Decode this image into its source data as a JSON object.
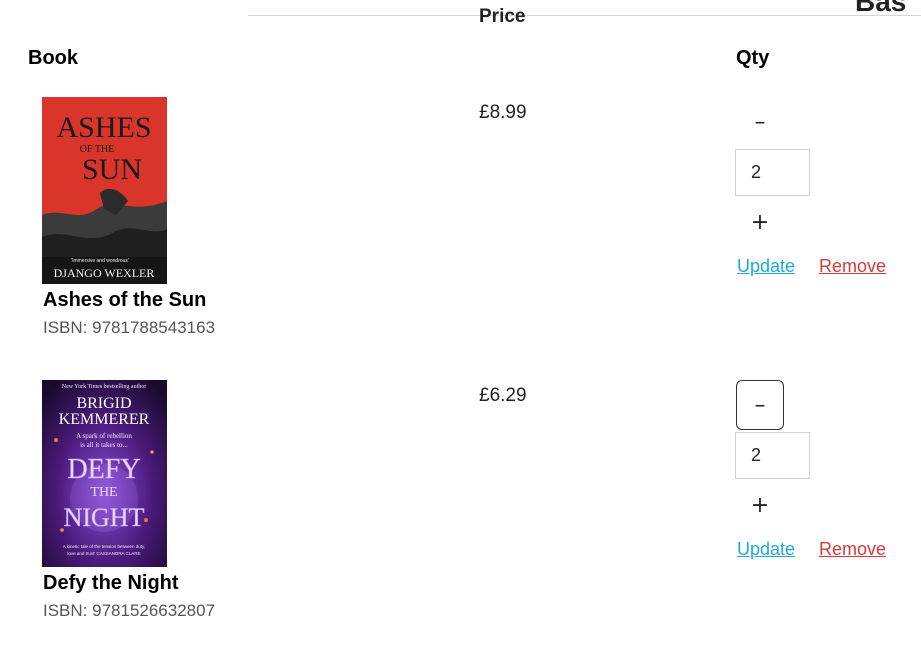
{
  "header": {
    "partial_title": "Bas",
    "book_col": "Book",
    "price_col": "Price",
    "qty_col": "Qty"
  },
  "items": [
    {
      "title": "Ashes of the Sun",
      "isbn": "ISBN: 9781788543163",
      "price": "£8.99",
      "qty": "2",
      "minus_icon": "minus-icon",
      "plus_icon": "plus-icon",
      "update_label": "Update",
      "remove_label": "Remove",
      "cover": {
        "title_line1": "ASHES",
        "title_line2": "OF THE",
        "title_line3": "SUN",
        "author": "DJANGO WEXLER",
        "blurb": "'Immersive and wondrous'",
        "bg": "#d9352a"
      }
    },
    {
      "title": "Defy the Night",
      "isbn": "ISBN: 9781526632807",
      "price": "£6.29",
      "qty": "2",
      "minus_icon": "minus-icon",
      "plus_icon": "plus-icon",
      "update_label": "Update",
      "remove_label": "Remove",
      "cover": {
        "top_line": "New York Times bestselling author",
        "author_line1": "BRIGID",
        "author_line2": "KEMMERER",
        "tagline_line1": "A spark of rebellion",
        "tagline_line2": "is all it takes to...",
        "title_line1": "DEFY",
        "title_line2": "THE",
        "title_line3": "NIGHT",
        "bottom_line1": "A kinetic tale of the tension between duty,",
        "bottom_line2": "love and trust' CASSANDRA CLARE",
        "bg": "#4a1a7a"
      }
    }
  ],
  "colors": {
    "update_link": "#1fa9d8",
    "remove_link": "#d33a3a",
    "isbn_text": "#555555"
  }
}
